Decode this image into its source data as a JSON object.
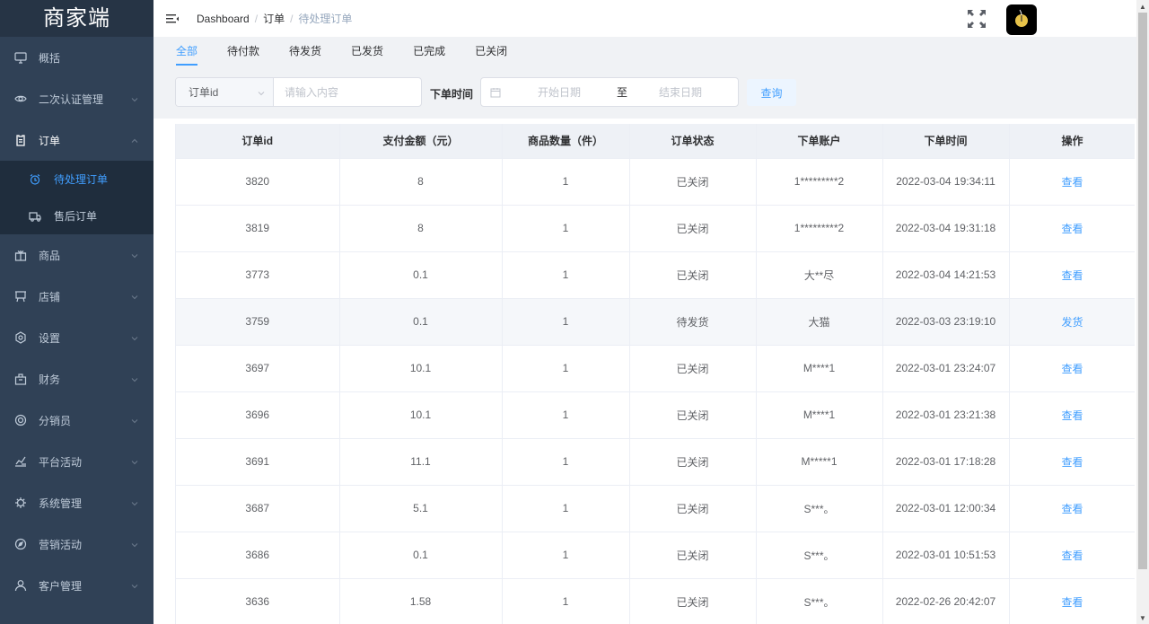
{
  "sidebar": {
    "logo": "商家端",
    "items": [
      {
        "label": "概括",
        "icon": "monitor-icon"
      },
      {
        "label": "二次认证管理",
        "icon": "eye-icon"
      },
      {
        "label": "订单",
        "icon": "clipboard-icon",
        "open": true
      },
      {
        "label": "商品",
        "icon": "gift-icon"
      },
      {
        "label": "店铺",
        "icon": "cart-icon"
      },
      {
        "label": "设置",
        "icon": "settings-icon"
      },
      {
        "label": "财务",
        "icon": "bag-icon"
      },
      {
        "label": "分销员",
        "icon": "target-icon"
      },
      {
        "label": "平台活动",
        "icon": "chart-icon"
      },
      {
        "label": "系统管理",
        "icon": "gear-icon"
      },
      {
        "label": "营销活动",
        "icon": "compass-icon"
      },
      {
        "label": "客户管理",
        "icon": "user-icon"
      }
    ],
    "sub_items": [
      {
        "label": "待处理订单",
        "icon": "alarm-icon",
        "active": true
      },
      {
        "label": "售后订单",
        "icon": "truck-icon"
      }
    ]
  },
  "header": {
    "breadcrumb": [
      "Dashboard",
      "订单",
      "待处理订单"
    ],
    "separator": "/"
  },
  "tabs": [
    "全部",
    "待付款",
    "待发货",
    "已发货",
    "已完成",
    "已关闭"
  ],
  "filters": {
    "select_value": "订单id",
    "input_placeholder": "请输入内容",
    "date_label": "下单时间",
    "start_placeholder": "开始日期",
    "range_separator": "至",
    "end_placeholder": "结束日期",
    "query_label": "查询"
  },
  "table": {
    "columns": [
      "订单id",
      "支付金额（元）",
      "商品数量（件）",
      "订单状态",
      "下单账户",
      "下单时间",
      "操作"
    ],
    "rows": [
      {
        "id": "3820",
        "amount": "8",
        "qty": "1",
        "status": "已关闭",
        "account": "1*********2",
        "time": "2022-03-04 19:34:11",
        "action": "查看"
      },
      {
        "id": "3819",
        "amount": "8",
        "qty": "1",
        "status": "已关闭",
        "account": "1*********2",
        "time": "2022-03-04 19:31:18",
        "action": "查看"
      },
      {
        "id": "3773",
        "amount": "0.1",
        "qty": "1",
        "status": "已关闭",
        "account": "大**尽",
        "time": "2022-03-04 14:21:53",
        "action": "查看"
      },
      {
        "id": "3759",
        "amount": "0.1",
        "qty": "1",
        "status": "待发货",
        "account": "大猫",
        "time": "2022-03-03 23:19:10",
        "action": "发货"
      },
      {
        "id": "3697",
        "amount": "10.1",
        "qty": "1",
        "status": "已关闭",
        "account": "M****1",
        "time": "2022-03-01 23:24:07",
        "action": "查看"
      },
      {
        "id": "3696",
        "amount": "10.1",
        "qty": "1",
        "status": "已关闭",
        "account": "M****1",
        "time": "2022-03-01 23:21:38",
        "action": "查看"
      },
      {
        "id": "3691",
        "amount": "11.1",
        "qty": "1",
        "status": "已关闭",
        "account": "M*****1",
        "time": "2022-03-01 17:18:28",
        "action": "查看"
      },
      {
        "id": "3687",
        "amount": "5.1",
        "qty": "1",
        "status": "已关闭",
        "account": "S***。",
        "time": "2022-03-01 12:00:34",
        "action": "查看"
      },
      {
        "id": "3686",
        "amount": "0.1",
        "qty": "1",
        "status": "已关闭",
        "account": "S***。",
        "time": "2022-03-01 10:51:53",
        "action": "查看"
      },
      {
        "id": "3636",
        "amount": "1.58",
        "qty": "1",
        "status": "已关闭",
        "account": "S***。",
        "time": "2022-02-26 20:42:07",
        "action": "查看"
      }
    ]
  },
  "colors": {
    "sidebar_bg": "#304156",
    "submenu_bg": "#1f2d3d",
    "accent": "#409eff"
  }
}
